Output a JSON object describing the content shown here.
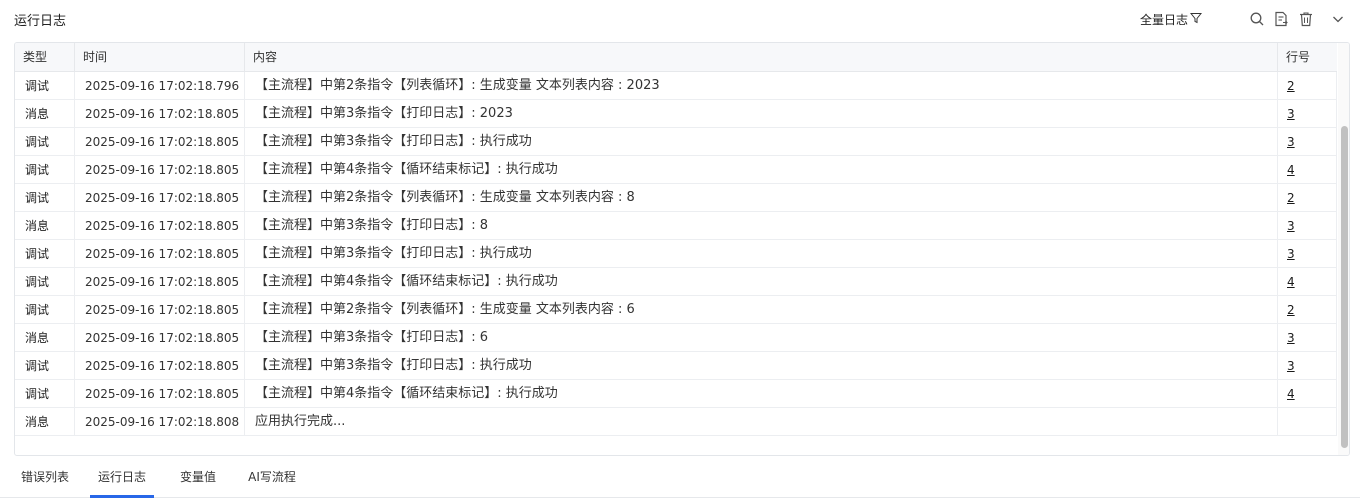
{
  "header": {
    "title": "运行日志",
    "filter_label": "全量日志",
    "icons": [
      "filter-icon",
      "search-icon",
      "export-icon",
      "trash-icon",
      "chevron-down-icon"
    ]
  },
  "table": {
    "columns": [
      "类型",
      "时间",
      "内容",
      "行号"
    ],
    "rows": [
      {
        "type": "调试",
        "time": "2025-09-16 17:02:18.796",
        "content": "【主流程】中第2条指令【列表循环】: 生成变量 文本列表内容 : 2023",
        "line": "2"
      },
      {
        "type": "消息",
        "time": "2025-09-16 17:02:18.805",
        "content": "【主流程】中第3条指令【打印日志】: 2023",
        "line": "3"
      },
      {
        "type": "调试",
        "time": "2025-09-16 17:02:18.805",
        "content": "【主流程】中第3条指令【打印日志】: 执行成功",
        "line": "3"
      },
      {
        "type": "调试",
        "time": "2025-09-16 17:02:18.805",
        "content": "【主流程】中第4条指令【循环结束标记】: 执行成功",
        "line": "4"
      },
      {
        "type": "调试",
        "time": "2025-09-16 17:02:18.805",
        "content": "【主流程】中第2条指令【列表循环】: 生成变量 文本列表内容 : 8",
        "line": "2"
      },
      {
        "type": "消息",
        "time": "2025-09-16 17:02:18.805",
        "content": "【主流程】中第3条指令【打印日志】: 8",
        "line": "3"
      },
      {
        "type": "调试",
        "time": "2025-09-16 17:02:18.805",
        "content": "【主流程】中第3条指令【打印日志】: 执行成功",
        "line": "3"
      },
      {
        "type": "调试",
        "time": "2025-09-16 17:02:18.805",
        "content": "【主流程】中第4条指令【循环结束标记】: 执行成功",
        "line": "4"
      },
      {
        "type": "调试",
        "time": "2025-09-16 17:02:18.805",
        "content": "【主流程】中第2条指令【列表循环】: 生成变量 文本列表内容 : 6",
        "line": "2"
      },
      {
        "type": "消息",
        "time": "2025-09-16 17:02:18.805",
        "content": "【主流程】中第3条指令【打印日志】: 6",
        "line": "3"
      },
      {
        "type": "调试",
        "time": "2025-09-16 17:02:18.805",
        "content": "【主流程】中第3条指令【打印日志】: 执行成功",
        "line": "3"
      },
      {
        "type": "调试",
        "time": "2025-09-16 17:02:18.805",
        "content": "【主流程】中第4条指令【循环结束标记】: 执行成功",
        "line": "4"
      },
      {
        "type": "消息",
        "time": "2025-09-16 17:02:18.808",
        "content": "应用执行完成...",
        "line": ""
      }
    ]
  },
  "tabs": [
    {
      "label": "错误列表",
      "active": false
    },
    {
      "label": "运行日志",
      "active": true
    },
    {
      "label": "变量值",
      "active": false
    },
    {
      "label": "AI写流程",
      "active": false
    }
  ],
  "colors": {
    "accent": "#2867e8",
    "header_bg": "#f7f8fa",
    "border": "#e6e8eb"
  }
}
